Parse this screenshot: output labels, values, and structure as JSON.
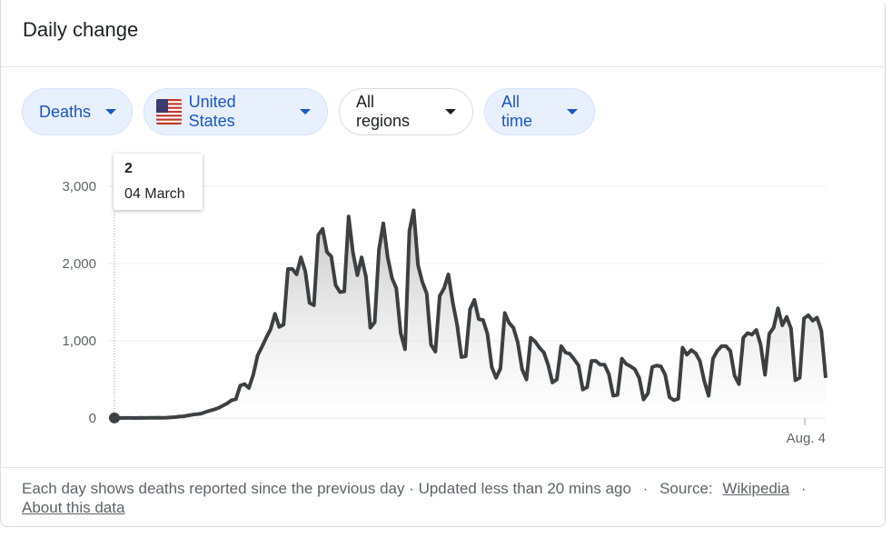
{
  "header": {
    "title": "Daily change"
  },
  "filters": [
    {
      "label": "Deaths",
      "style": "blue"
    },
    {
      "label": "United States",
      "style": "blue",
      "icon": "us-flag-icon"
    },
    {
      "label": "All regions",
      "style": "white"
    },
    {
      "label": "All time",
      "style": "white-blue"
    }
  ],
  "tooltip": {
    "value": "2",
    "date": "04 March"
  },
  "footer": {
    "description": "Each day shows deaths reported since the previous day · Updated less than 20 mins ago",
    "separator": "·",
    "source_label": "Source:",
    "source_link": "Wikipedia",
    "about_link": "About this data"
  },
  "colors": {
    "line": "#3c4043",
    "accent": "#1a56c8",
    "chip_bg": "#e8f0fe"
  },
  "chart_data": {
    "type": "area",
    "title": "",
    "xlabel": "",
    "ylabel": "",
    "ylim": [
      0,
      3000
    ],
    "yticks": [
      "0",
      "1,000",
      "2,000",
      "3,000"
    ],
    "xtick_labels": [
      "Aug. 4"
    ],
    "grid": true,
    "series": [
      {
        "values": [
          2,
          0,
          1,
          1,
          1,
          0,
          2,
          1,
          2,
          3,
          5,
          2,
          5,
          9,
          12,
          19,
          22,
          34,
          44,
          50,
          58,
          78,
          95,
          110,
          130,
          160,
          190,
          230,
          245,
          420,
          440,
          390,
          560,
          810,
          920,
          1040,
          1150,
          1350,
          1180,
          1210,
          1930,
          1930,
          1860,
          2080,
          1900,
          1490,
          1460,
          2370,
          2450,
          2150,
          2090,
          1720,
          1630,
          1640,
          2610,
          2140,
          1850,
          2080,
          1830,
          1170,
          1240,
          2180,
          2520,
          2080,
          1810,
          1680,
          1100,
          890,
          2420,
          2690,
          1980,
          1760,
          1610,
          950,
          860,
          1580,
          1680,
          1860,
          1500,
          1210,
          790,
          800,
          1410,
          1530,
          1280,
          1270,
          1090,
          660,
          520,
          640,
          1360,
          1230,
          1170,
          980,
          630,
          500,
          1040,
          990,
          910,
          850,
          690,
          460,
          500,
          930,
          850,
          830,
          760,
          680,
          370,
          400,
          740,
          740,
          690,
          690,
          570,
          290,
          300,
          770,
          700,
          670,
          630,
          520,
          240,
          320,
          660,
          680,
          670,
          560,
          270,
          230,
          250,
          910,
          820,
          880,
          840,
          740,
          480,
          290,
          770,
          870,
          930,
          930,
          870,
          550,
          440,
          1040,
          1100,
          1080,
          1140,
          950,
          560,
          1090,
          1170,
          1420,
          1200,
          1310,
          1160,
          490,
          520,
          1290,
          1330,
          1260,
          1300,
          1130,
          520
        ]
      }
    ]
  }
}
